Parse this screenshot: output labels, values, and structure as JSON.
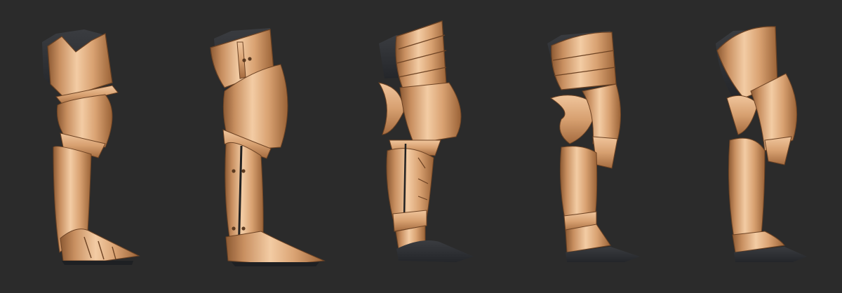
{
  "scene": {
    "background": "#2b2b2b",
    "subject": "armored-leg-renders",
    "views": [
      "front",
      "side-rear",
      "side",
      "three-quarter",
      "front-right"
    ],
    "colors": {
      "bronze_light": "#f2c8a0",
      "bronze_mid": "#d39a6a",
      "bronze_dark": "#9a6236",
      "under_material": "#2f3135"
    }
  }
}
